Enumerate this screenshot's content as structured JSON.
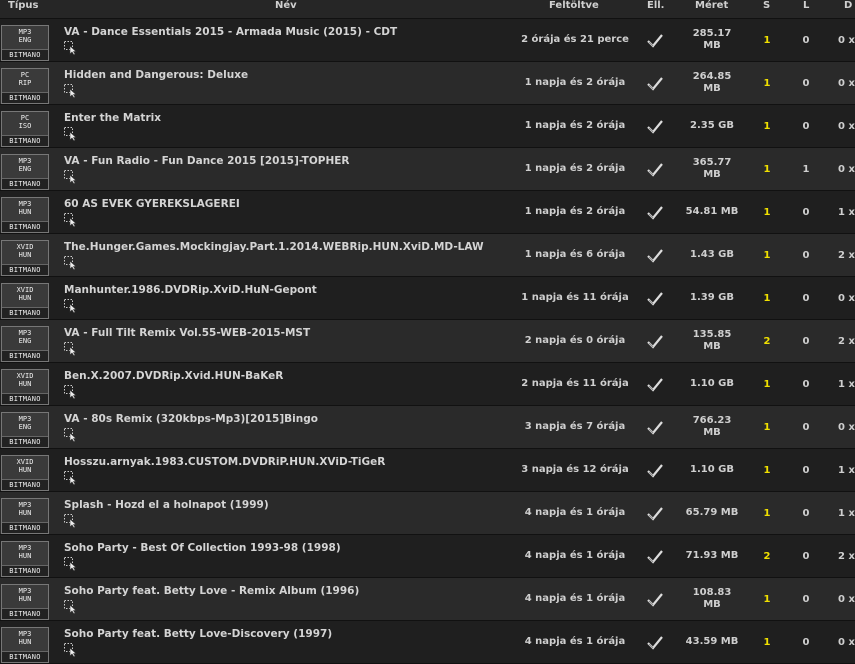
{
  "header": {
    "type": "Típus",
    "name": "Név",
    "uploaded": "Feltöltve",
    "checked": "Ell.",
    "size": "Méret",
    "seed": "S",
    "leech": "L",
    "done": "D"
  },
  "rows": [
    {
      "t1": "MP3",
      "t2": "ENG",
      "bm": "BITMANO",
      "name": "VA - Dance Essentials 2015 - Armada Music (2015) - CDT",
      "uploaded": "2 órája és 21 perce",
      "size": "285.17 MB",
      "seed": "1",
      "leech": "0",
      "done": "0 x"
    },
    {
      "t1": "PC",
      "t2": "RIP",
      "bm": "BITMANO",
      "name": "Hidden and Dangerous: Deluxe",
      "uploaded": "1 napja és 2 órája",
      "size": "264.85 MB",
      "seed": "1",
      "leech": "0",
      "done": "0 x"
    },
    {
      "t1": "PC",
      "t2": "ISO",
      "bm": "BITMANO",
      "name": "Enter the Matrix",
      "uploaded": "1 napja és 2 órája",
      "size": "2.35 GB",
      "seed": "1",
      "leech": "0",
      "done": "0 x"
    },
    {
      "t1": "MP3",
      "t2": "ENG",
      "bm": "BITMANO",
      "name": "VA - Fun Radio - Fun Dance 2015 [2015]-TOPHER",
      "uploaded": "1 napja és 2 órája",
      "size": "365.77 MB",
      "seed": "1",
      "leech": "1",
      "done": "0 x"
    },
    {
      "t1": "MP3",
      "t2": "HUN",
      "bm": "BITMANO",
      "name": "60 AS EVEK GYEREKSLAGEREI",
      "uploaded": "1 napja és 2 órája",
      "size": "54.81 MB",
      "seed": "1",
      "leech": "0",
      "done": "1 x"
    },
    {
      "t1": "XVID",
      "t2": "HUN",
      "bm": "BITMANO",
      "name": "The.Hunger.Games.Mockingjay.Part.1.2014.WEBRip.HUN.XviD.MD-LAW",
      "uploaded": "1 napja és 6 órája",
      "size": "1.43 GB",
      "seed": "1",
      "leech": "0",
      "done": "2 x"
    },
    {
      "t1": "XVID",
      "t2": "HUN",
      "bm": "BITMANO",
      "name": "Manhunter.1986.DVDRip.XviD.HuN-Gepont",
      "uploaded": "1 napja és 11 órája",
      "size": "1.39 GB",
      "seed": "1",
      "leech": "0",
      "done": "0 x"
    },
    {
      "t1": "MP3",
      "t2": "ENG",
      "bm": "BITMANO",
      "name": "VA - Full Tilt Remix Vol.55-WEB-2015-MST",
      "uploaded": "2 napja és 0 órája",
      "size": "135.85 MB",
      "seed": "2",
      "leech": "0",
      "done": "2 x"
    },
    {
      "t1": "XVID",
      "t2": "HUN",
      "bm": "BITMANO",
      "name": "Ben.X.2007.DVDRip.Xvid.HUN-BaKeR",
      "uploaded": "2 napja és 11 órája",
      "size": "1.10 GB",
      "seed": "1",
      "leech": "0",
      "done": "1 x"
    },
    {
      "t1": "MP3",
      "t2": "ENG",
      "bm": "BITMANO",
      "name": "VA - 80s Remix (320kbps-Mp3)[2015]Bingo",
      "uploaded": "3 napja és 7 órája",
      "size": "766.23 MB",
      "seed": "1",
      "leech": "0",
      "done": "0 x"
    },
    {
      "t1": "XVID",
      "t2": "HUN",
      "bm": "BITMANO",
      "name": "Hosszu.arnyak.1983.CUSTOM.DVDRiP.HUN.XViD-TiGeR",
      "uploaded": "3 napja és 12 órája",
      "size": "1.10 GB",
      "seed": "1",
      "leech": "0",
      "done": "1 x"
    },
    {
      "t1": "MP3",
      "t2": "HUN",
      "bm": "BITMANO",
      "name": "Splash - Hozd el a holnapot (1999)",
      "uploaded": "4 napja és 1 órája",
      "size": "65.79 MB",
      "seed": "1",
      "leech": "0",
      "done": "1 x"
    },
    {
      "t1": "MP3",
      "t2": "HUN",
      "bm": "BITMANO",
      "name": "Soho Party - Best Of Collection 1993-98 (1998)",
      "uploaded": "4 napja és 1 órája",
      "size": "71.93 MB",
      "seed": "2",
      "leech": "0",
      "done": "2 x"
    },
    {
      "t1": "MP3",
      "t2": "HUN",
      "bm": "BITMANO",
      "name": "Soho Party feat. Betty Love - Remix Album (1996)",
      "uploaded": "4 napja és 1 órája",
      "size": "108.83 MB",
      "seed": "1",
      "leech": "0",
      "done": "0 x"
    },
    {
      "t1": "MP3",
      "t2": "HUN",
      "bm": "BITMANO",
      "name": "Soho Party feat. Betty Love-Discovery (1997)",
      "uploaded": "4 napja és 1 órája",
      "size": "43.59 MB",
      "seed": "1",
      "leech": "0",
      "done": "0 x"
    }
  ],
  "icons": {
    "download": "download-cursor-icon",
    "checked": "checkmark-icon"
  },
  "colors": {
    "seed": "#f0e000",
    "background": "#1c1c1c",
    "row_alt": "#2a2a2a"
  }
}
